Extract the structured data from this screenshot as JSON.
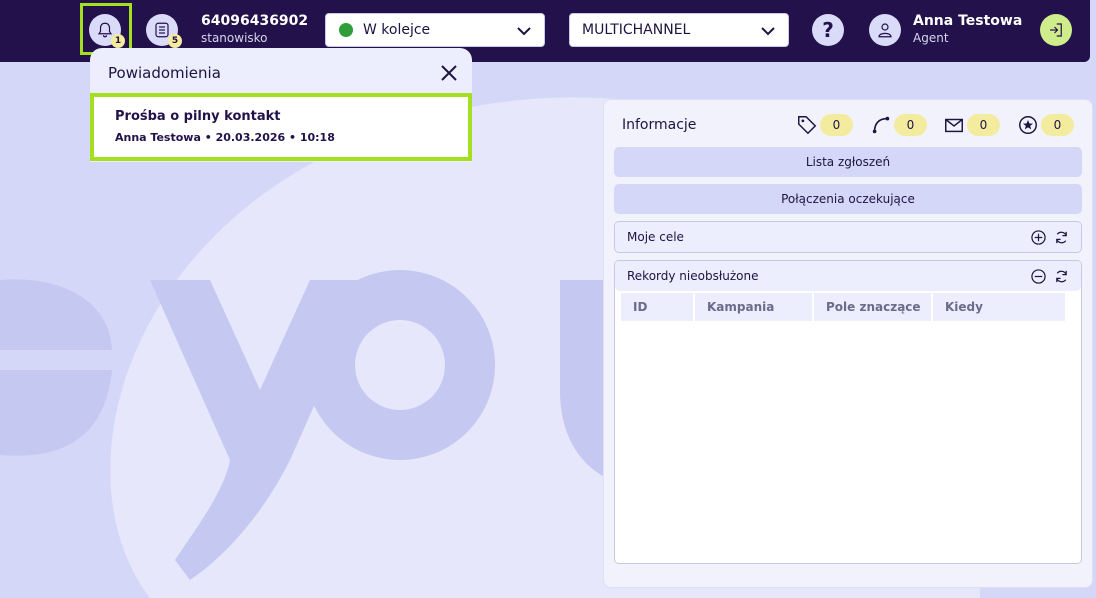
{
  "topbar": {
    "notifications_count": "1",
    "tasks_count": "5",
    "station_number": "64096436902",
    "station_label": "stanowisko",
    "status_value": "W kolejce",
    "channel_value": "MULTICHANNEL",
    "help_label": "?",
    "user_name": "Anna Testowa",
    "user_role": "Agent"
  },
  "notifications": {
    "title": "Powiadomienia",
    "items": [
      {
        "title": "Prośba o pilny kontakt",
        "meta": "Anna Testowa • 20.03.2026 • 10:18"
      }
    ]
  },
  "info": {
    "title": "Informacje",
    "counters": [
      {
        "icon": "tag-icon",
        "value": "0"
      },
      {
        "icon": "phone-icon",
        "value": "0"
      },
      {
        "icon": "mail-icon",
        "value": "0"
      },
      {
        "icon": "star-icon",
        "value": "0"
      }
    ],
    "tickets_button": "Lista zgłoszeń",
    "waiting_calls_button": "Połączenia oczekujące",
    "goals_section": "Moje cele",
    "records_section": "Rekordy nieobsłużone",
    "columns": [
      "ID",
      "Kampania",
      "Pole znaczące",
      "Kiedy"
    ]
  },
  "colors": {
    "topbar": "#22114a",
    "background": "#d5d7f8",
    "highlight": "#a5e020",
    "badge": "#f3ec9f",
    "status_green": "#2e9d3a"
  }
}
